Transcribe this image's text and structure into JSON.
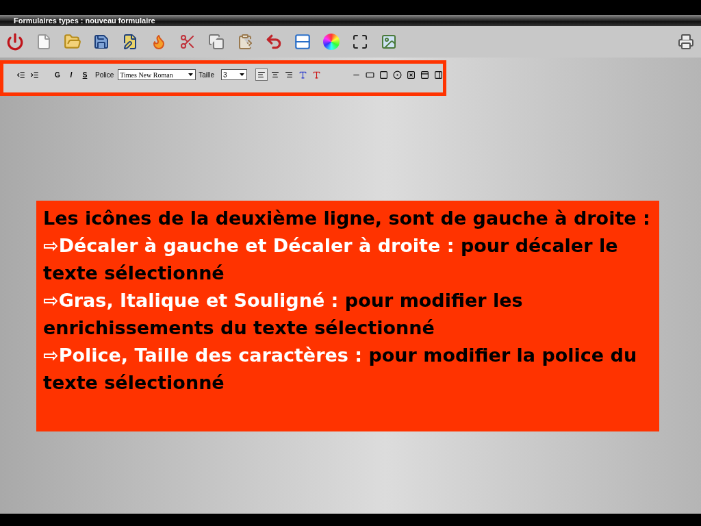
{
  "window": {
    "title": "Formulaires types : nouveau formulaire"
  },
  "format_bar": {
    "style_buttons": [
      "G",
      "I",
      "S"
    ],
    "font_label": "Police",
    "font_value": "Times New Roman",
    "size_label": "Taille",
    "size_value": "3",
    "align_buttons": [
      {
        "kind": "left",
        "selected": true
      },
      {
        "kind": "center",
        "selected": false
      },
      {
        "kind": "right",
        "selected": false
      }
    ]
  },
  "callout": {
    "intro": "Les icônes de la deuxième ligne, sont de gauche à droite :",
    "items": [
      {
        "bullet": "⇨",
        "term": "Décaler à gauche et Décaler à droite :",
        "text": "pour décaler le texte sélectionné"
      },
      {
        "bullet": "⇨",
        "term": "Gras, Italique et Souligné :",
        "text": "pour modifier les enrichissements du texte sélectionné"
      },
      {
        "bullet": "⇨",
        "term": "Police, Taille des caractères :",
        "text": "pour modifier la police du texte sélectionné"
      }
    ]
  }
}
